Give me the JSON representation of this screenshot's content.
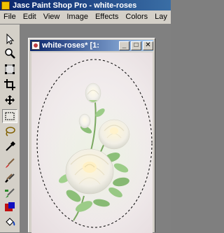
{
  "app": {
    "title": "Jasc Paint Shop Pro - white-roses"
  },
  "menu": {
    "items": [
      "File",
      "Edit",
      "View",
      "Image",
      "Effects",
      "Colors",
      "Lay"
    ]
  },
  "tools": [
    {
      "name": "arrow-tool",
      "icon": "arrow-icon"
    },
    {
      "name": "zoom-tool",
      "icon": "magnifier-icon"
    },
    {
      "name": "deform-tool",
      "icon": "deform-icon"
    },
    {
      "name": "crop-tool",
      "icon": "crop-icon"
    },
    {
      "name": "mover-tool",
      "icon": "move-icon"
    },
    {
      "name": "selection-tool",
      "icon": "selection-icon",
      "active": true
    },
    {
      "name": "freehand-tool",
      "icon": "lasso-icon"
    },
    {
      "name": "dropper-tool",
      "icon": "dropper-icon"
    },
    {
      "name": "paintbrush-tool",
      "icon": "brush-icon"
    },
    {
      "name": "clone-tool",
      "icon": "clone-brush-icon"
    },
    {
      "name": "color-replacer-tool",
      "icon": "color-replacer-icon"
    },
    {
      "name": "retouch-tool",
      "icon": "retouch-icon"
    },
    {
      "name": "flood-fill-tool",
      "icon": "flood-fill-icon"
    },
    {
      "name": "picture-tube-tool",
      "icon": "picture-tube-icon"
    }
  ],
  "document": {
    "title": "white-roses* [1:",
    "buttons": {
      "minimize": "_",
      "maximize": "□",
      "close": "✕"
    }
  },
  "colors": {
    "title_bar": "#0a246a",
    "chrome": "#d4d0c8",
    "workspace": "#808080"
  }
}
